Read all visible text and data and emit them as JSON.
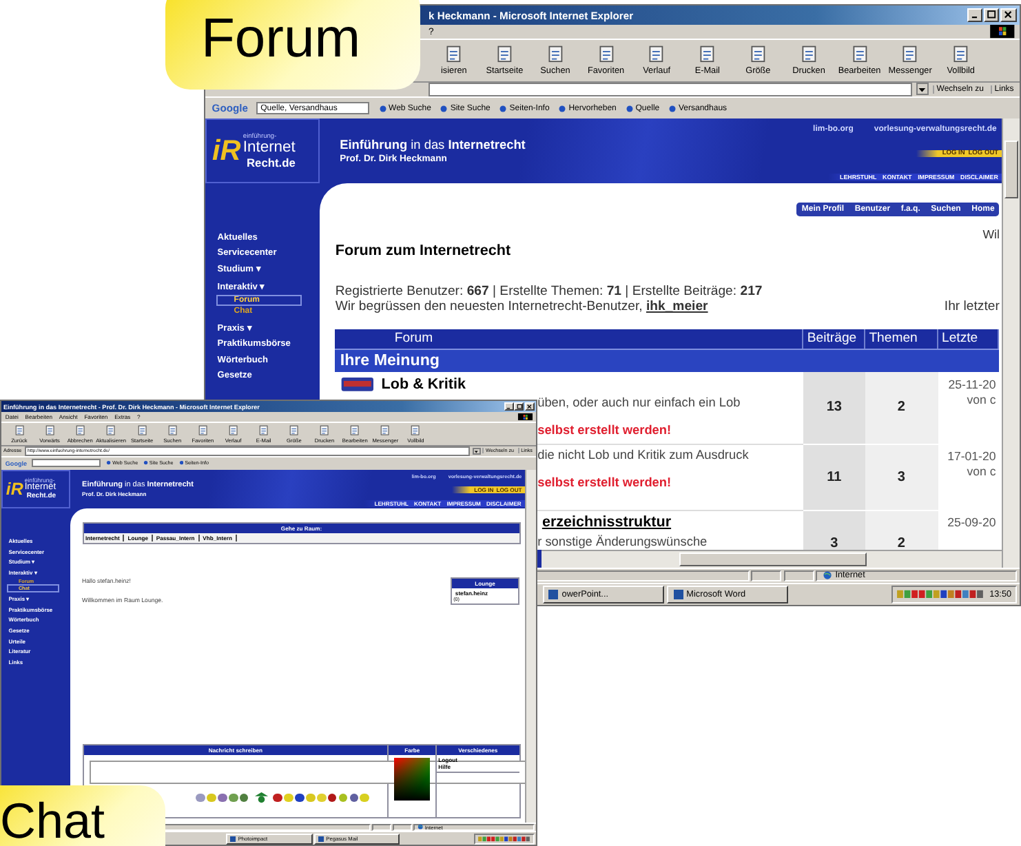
{
  "callouts": [
    {
      "text": "Forum"
    },
    {
      "text": "Chat"
    }
  ],
  "forum_window": {
    "title": "k Heckmann - Microsoft Internet Explorer",
    "menu": [
      "?"
    ],
    "toolbar": [
      "isieren",
      "Startseite",
      "Suchen",
      "Favoriten",
      "Verlauf",
      "E-Mail",
      "Größe",
      "Drucken",
      "Bearbeiten",
      "Messenger",
      "Vollbild"
    ],
    "address": {
      "go": "Wechseln zu",
      "links": "Links"
    },
    "google": {
      "logo": "Google",
      "query": "Quelle, Versandhaus",
      "buttons": [
        "Web Suche",
        "Site Suche",
        "Seiten-Info",
        "Hervorheben",
        "Quelle",
        "Versandhaus"
      ]
    },
    "site": {
      "logo_mark": "iR",
      "logo_lines": [
        "einführung-",
        "Internet",
        "Recht.de"
      ],
      "title": "**Einführung** in das **Internetrecht**",
      "subtitle": "Prof. Dr. Dirk Heckmann",
      "links": [
        "lim-bo.org",
        "vorlesung-verwaltungsrecht.de"
      ],
      "login": [
        "LOG IN",
        "LOG OUT"
      ],
      "nav": [
        "LEHRSTUHL",
        "KONTAKT",
        "IMPRESSUM",
        "DISCLAIMER"
      ]
    },
    "sidebar": {
      "items": [
        {
          "label": "Aktuelles"
        },
        {
          "label": "Servicecenter"
        },
        {
          "label": "Studium ▾"
        },
        {
          "label": "Interaktiv ▾",
          "children": [
            {
              "label": "Forum",
              "selected": true
            },
            {
              "label": "Chat",
              "selected": false
            }
          ]
        },
        {
          "label": "Praxis ▾"
        },
        {
          "label": "Praktikumsbörse"
        },
        {
          "label": "Wörterbuch"
        },
        {
          "label": "Gesetze"
        }
      ]
    },
    "forum": {
      "nav": [
        "Mein Profil",
        "Benutzer",
        "f.a.q.",
        "Suchen",
        "Home"
      ],
      "corner_text": "Wil",
      "heading": "Forum zum Internetrecht",
      "stats": "Registrierte Benutzer: **667** | Erstellte Themen: **71** | Erstellte Beiträge: **217**",
      "welcome": "Wir begrüssen den neuesten Internetrecht-Benutzer, ",
      "newest_user": "ihk_meier",
      "last_visit": "Ihr letzter",
      "columns": [
        "Forum",
        "Beiträge",
        "Themen",
        "Letzte"
      ],
      "category": "Ihre Meinung",
      "rows": [
        {
          "title": "Lob & Kritik",
          "icon": true,
          "description": "üben, oder auch nur einfach ein Lob",
          "note": "selbst erstellt werden!",
          "posts": "13",
          "topics": "2",
          "date": "25-11-20",
          "by": "von c"
        },
        {
          "description": "die nicht Lob und Kritik zum Ausdruck",
          "note": "selbst erstellt werden!",
          "posts": "11",
          "topics": "3",
          "date": "17-01-20",
          "by": "von c"
        },
        {
          "title": "erzeichnisstruktur",
          "icon": false,
          "description": "r sonstige Änderungswünsche",
          "posts": "3",
          "topics": "2",
          "date": "25-09-20"
        }
      ]
    },
    "status": "Internet",
    "taskbar": [
      "owerPoint...",
      "Microsoft Word"
    ],
    "clock": "13:50"
  },
  "chat_window": {
    "title": "Einführung in das Internetrecht - Prof. Dr. Dirk Heckmann - Microsoft Internet Explorer",
    "menu": [
      "Datei",
      "Bearbeiten",
      "Ansicht",
      "Favoriten",
      "Extras",
      "?"
    ],
    "toolbar": [
      "Zurück",
      "Vorwärts",
      "Abbrechen",
      "Aktualisieren",
      "Startseite",
      "Suchen",
      "Favoriten",
      "Verlauf",
      "E-Mail",
      "Größe",
      "Drucken",
      "Bearbeiten",
      "Messenger",
      "Vollbild"
    ],
    "address": {
      "label": "Adresse",
      "url": "http://www.einfuehrung-internetrecht.de/",
      "go": "Wechseln zu",
      "links": "Links"
    },
    "google": {
      "logo": "Google",
      "buttons": [
        "Web Suche",
        "Site Suche",
        "Seiten-Info"
      ]
    },
    "site": {
      "logo_mark": "iR",
      "logo_lines": [
        "einführung-",
        "Internet",
        "Recht.de"
      ],
      "title": "**Einführung** in das **Internetrecht**",
      "subtitle": "Prof. Dr. Dirk Heckmann",
      "links": [
        "lim-bo.org",
        "vorlesung-verwaltungsrecht.de"
      ],
      "login": [
        "LOG IN",
        "LOG OUT"
      ],
      "nav": [
        "LEHRSTUHL",
        "KONTAKT",
        "IMPRESSUM",
        "DISCLAIMER"
      ]
    },
    "sidebar": {
      "items": [
        {
          "label": "Aktuelles"
        },
        {
          "label": "Servicecenter"
        },
        {
          "label": "Studium ▾"
        },
        {
          "label": "Interaktiv ▾",
          "children": [
            {
              "label": "Forum",
              "selected": false
            },
            {
              "label": "Chat",
              "selected": true
            }
          ]
        },
        {
          "label": "Praxis ▾"
        },
        {
          "label": "Praktikumsbörse"
        },
        {
          "label": "Wörterbuch"
        },
        {
          "label": "Gesetze"
        },
        {
          "label": "Urteile"
        },
        {
          "label": "Literatur"
        },
        {
          "label": "Links"
        }
      ]
    },
    "chat": {
      "rooms_title": "Gehe zu Raum:",
      "rooms": [
        "Internetrecht",
        "Lounge",
        "Passau_Intern",
        "Vhb_Intern"
      ],
      "greeting": "Hallo stefan.heinz!",
      "welcome": "Willkommen im Raum Lounge.",
      "room_box": {
        "title": "Lounge",
        "users": [
          "stefan.heinz"
        ],
        "count": "(0)"
      },
      "compose_title": "Nachricht schreiben",
      "color_title": "Farbe",
      "misc_title": "Verschiedenes",
      "misc_links": [
        "Logout",
        "Hilfe"
      ],
      "smileys": [
        {
          "color": "#9a9ac0"
        },
        {
          "color": "#d8c820"
        },
        {
          "color": "#8a70b0"
        },
        {
          "color": "#70a050"
        },
        {
          "color": "#508040"
        },
        {
          "color": "#c02020"
        },
        {
          "color": "#e0d020"
        },
        {
          "color": "#2040c0"
        },
        {
          "color": "#d8c820"
        },
        {
          "color": "#e0d030"
        },
        {
          "color": "#b01818"
        },
        {
          "color": "#a8c020"
        },
        {
          "color": "#6060a0"
        },
        {
          "color": "#d8d020"
        }
      ]
    },
    "status": "Internet",
    "taskbar": [
      "Photoimpact",
      "Pegasus Mail"
    ]
  }
}
